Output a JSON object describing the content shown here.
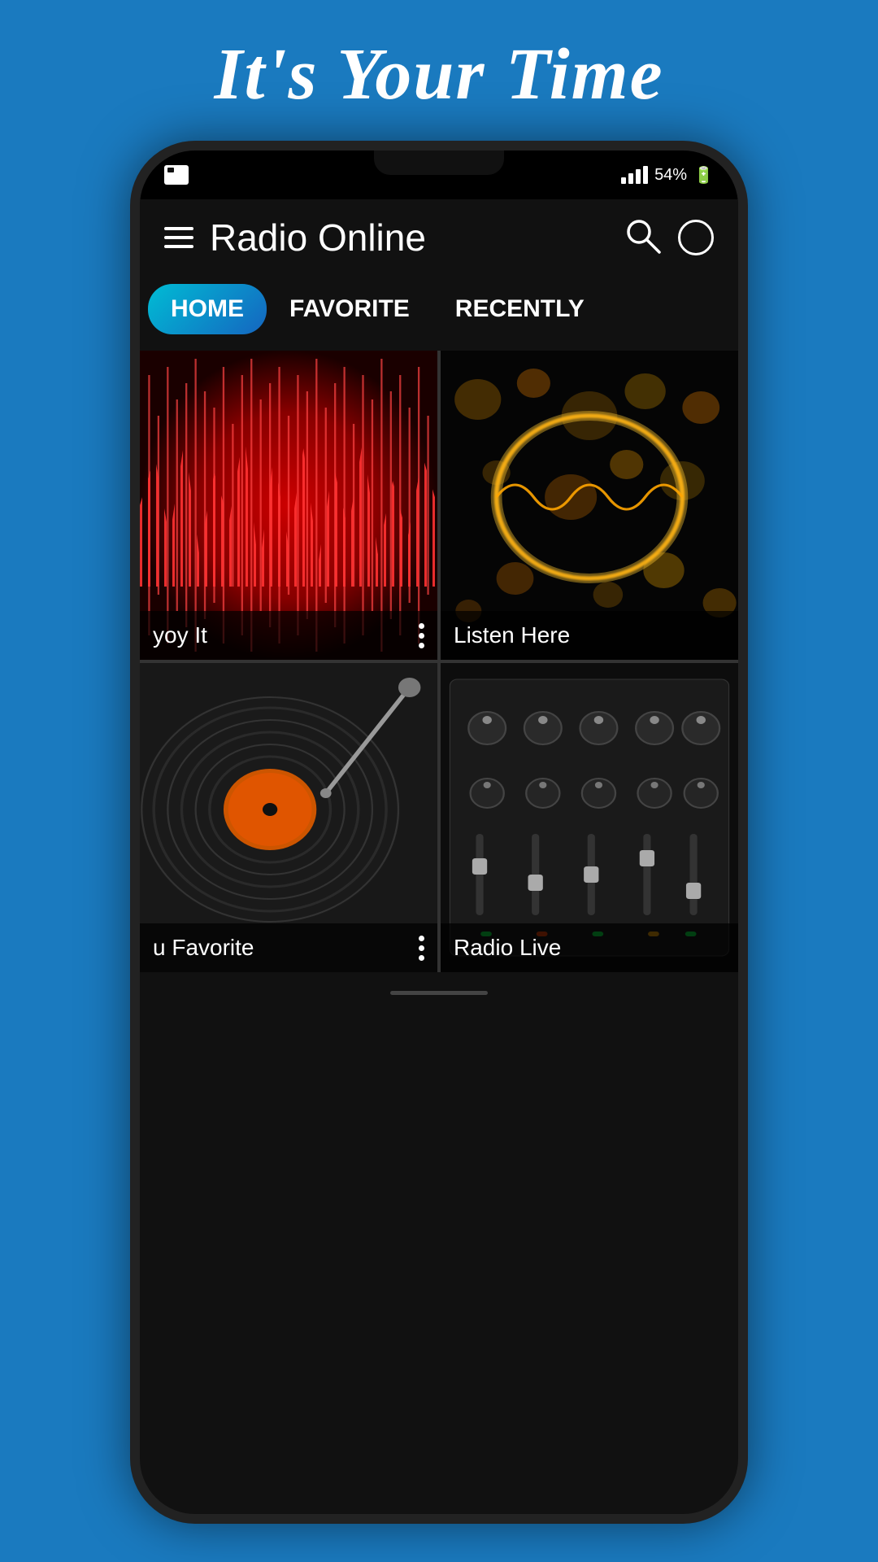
{
  "page": {
    "background_title": "It's Your Time",
    "app_title": "Radio Online",
    "status_battery": "54%",
    "tabs": [
      {
        "id": "home",
        "label": "HOME",
        "active": true
      },
      {
        "id": "favorite",
        "label": "FAVORITE",
        "active": false
      },
      {
        "id": "recent",
        "label": "RECENTLY",
        "active": false
      }
    ],
    "grid_items": [
      {
        "id": "item1",
        "label": "yoy It",
        "has_more": true,
        "type": "red-wave"
      },
      {
        "id": "item2",
        "label": "Listen Here",
        "has_more": false,
        "type": "gold-bokeh"
      },
      {
        "id": "item3",
        "label": "u Favorite",
        "has_more": true,
        "type": "vinyl"
      },
      {
        "id": "item4",
        "label": "Radio Live",
        "has_more": false,
        "type": "mixer"
      }
    ],
    "menu_icon_label": "menu",
    "search_icon_label": "search",
    "more_icon_label": "more"
  }
}
